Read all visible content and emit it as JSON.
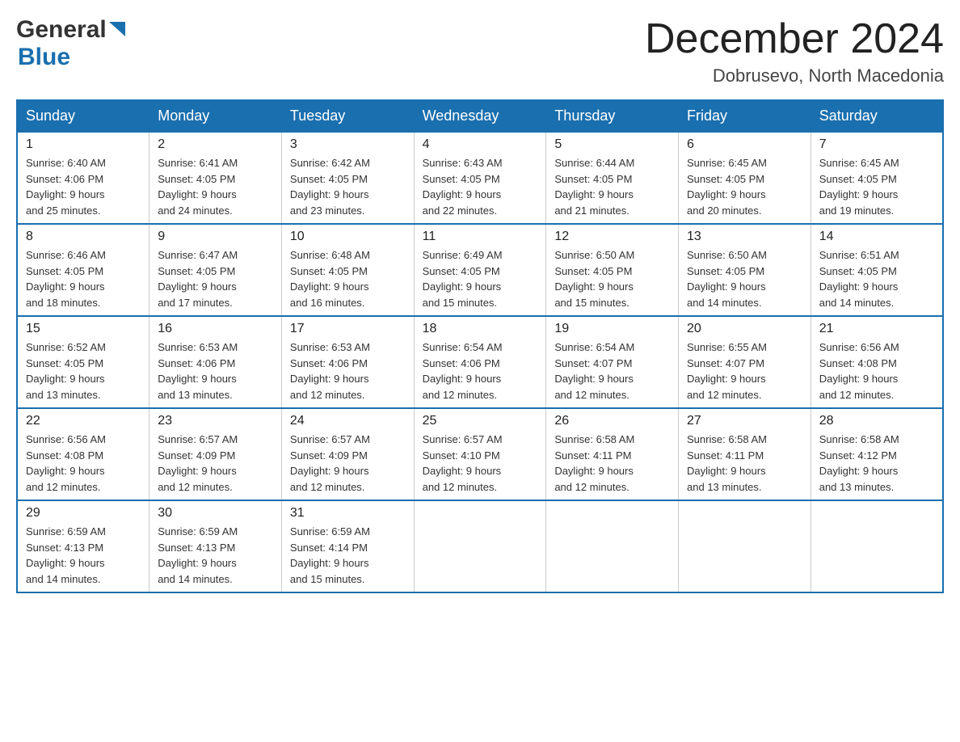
{
  "header": {
    "month_title": "December 2024",
    "location": "Dobrusevo, North Macedonia"
  },
  "weekdays": [
    "Sunday",
    "Monday",
    "Tuesday",
    "Wednesday",
    "Thursday",
    "Friday",
    "Saturday"
  ],
  "weeks": [
    [
      {
        "day": "1",
        "sunrise": "6:40 AM",
        "sunset": "4:06 PM",
        "daylight": "9 hours and 25 minutes."
      },
      {
        "day": "2",
        "sunrise": "6:41 AM",
        "sunset": "4:05 PM",
        "daylight": "9 hours and 24 minutes."
      },
      {
        "day": "3",
        "sunrise": "6:42 AM",
        "sunset": "4:05 PM",
        "daylight": "9 hours and 23 minutes."
      },
      {
        "day": "4",
        "sunrise": "6:43 AM",
        "sunset": "4:05 PM",
        "daylight": "9 hours and 22 minutes."
      },
      {
        "day": "5",
        "sunrise": "6:44 AM",
        "sunset": "4:05 PM",
        "daylight": "9 hours and 21 minutes."
      },
      {
        "day": "6",
        "sunrise": "6:45 AM",
        "sunset": "4:05 PM",
        "daylight": "9 hours and 20 minutes."
      },
      {
        "day": "7",
        "sunrise": "6:45 AM",
        "sunset": "4:05 PM",
        "daylight": "9 hours and 19 minutes."
      }
    ],
    [
      {
        "day": "8",
        "sunrise": "6:46 AM",
        "sunset": "4:05 PM",
        "daylight": "9 hours and 18 minutes."
      },
      {
        "day": "9",
        "sunrise": "6:47 AM",
        "sunset": "4:05 PM",
        "daylight": "9 hours and 17 minutes."
      },
      {
        "day": "10",
        "sunrise": "6:48 AM",
        "sunset": "4:05 PM",
        "daylight": "9 hours and 16 minutes."
      },
      {
        "day": "11",
        "sunrise": "6:49 AM",
        "sunset": "4:05 PM",
        "daylight": "9 hours and 15 minutes."
      },
      {
        "day": "12",
        "sunrise": "6:50 AM",
        "sunset": "4:05 PM",
        "daylight": "9 hours and 15 minutes."
      },
      {
        "day": "13",
        "sunrise": "6:50 AM",
        "sunset": "4:05 PM",
        "daylight": "9 hours and 14 minutes."
      },
      {
        "day": "14",
        "sunrise": "6:51 AM",
        "sunset": "4:05 PM",
        "daylight": "9 hours and 14 minutes."
      }
    ],
    [
      {
        "day": "15",
        "sunrise": "6:52 AM",
        "sunset": "4:05 PM",
        "daylight": "9 hours and 13 minutes."
      },
      {
        "day": "16",
        "sunrise": "6:53 AM",
        "sunset": "4:06 PM",
        "daylight": "9 hours and 13 minutes."
      },
      {
        "day": "17",
        "sunrise": "6:53 AM",
        "sunset": "4:06 PM",
        "daylight": "9 hours and 12 minutes."
      },
      {
        "day": "18",
        "sunrise": "6:54 AM",
        "sunset": "4:06 PM",
        "daylight": "9 hours and 12 minutes."
      },
      {
        "day": "19",
        "sunrise": "6:54 AM",
        "sunset": "4:07 PM",
        "daylight": "9 hours and 12 minutes."
      },
      {
        "day": "20",
        "sunrise": "6:55 AM",
        "sunset": "4:07 PM",
        "daylight": "9 hours and 12 minutes."
      },
      {
        "day": "21",
        "sunrise": "6:56 AM",
        "sunset": "4:08 PM",
        "daylight": "9 hours and 12 minutes."
      }
    ],
    [
      {
        "day": "22",
        "sunrise": "6:56 AM",
        "sunset": "4:08 PM",
        "daylight": "9 hours and 12 minutes."
      },
      {
        "day": "23",
        "sunrise": "6:57 AM",
        "sunset": "4:09 PM",
        "daylight": "9 hours and 12 minutes."
      },
      {
        "day": "24",
        "sunrise": "6:57 AM",
        "sunset": "4:09 PM",
        "daylight": "9 hours and 12 minutes."
      },
      {
        "day": "25",
        "sunrise": "6:57 AM",
        "sunset": "4:10 PM",
        "daylight": "9 hours and 12 minutes."
      },
      {
        "day": "26",
        "sunrise": "6:58 AM",
        "sunset": "4:11 PM",
        "daylight": "9 hours and 12 minutes."
      },
      {
        "day": "27",
        "sunrise": "6:58 AM",
        "sunset": "4:11 PM",
        "daylight": "9 hours and 13 minutes."
      },
      {
        "day": "28",
        "sunrise": "6:58 AM",
        "sunset": "4:12 PM",
        "daylight": "9 hours and 13 minutes."
      }
    ],
    [
      {
        "day": "29",
        "sunrise": "6:59 AM",
        "sunset": "4:13 PM",
        "daylight": "9 hours and 14 minutes."
      },
      {
        "day": "30",
        "sunrise": "6:59 AM",
        "sunset": "4:13 PM",
        "daylight": "9 hours and 14 minutes."
      },
      {
        "day": "31",
        "sunrise": "6:59 AM",
        "sunset": "4:14 PM",
        "daylight": "9 hours and 15 minutes."
      },
      null,
      null,
      null,
      null
    ]
  ],
  "labels": {
    "sunrise": "Sunrise:",
    "sunset": "Sunset:",
    "daylight": "Daylight:"
  }
}
